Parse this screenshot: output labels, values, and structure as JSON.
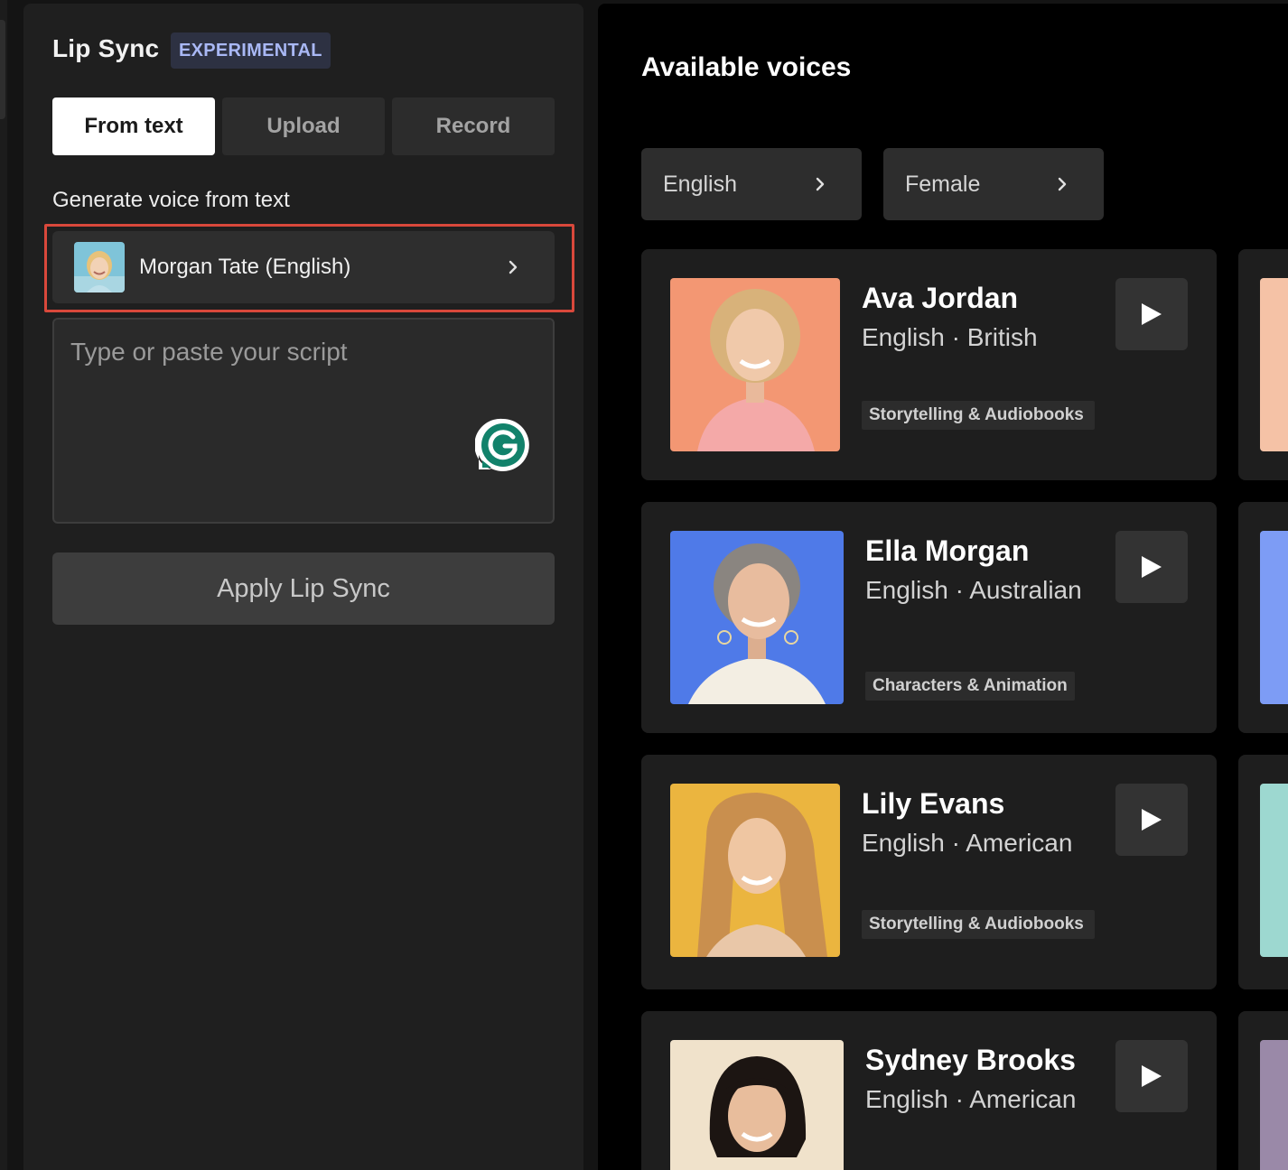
{
  "left_panel": {
    "title": "Lip Sync",
    "badge": "EXPERIMENTAL",
    "tabs": [
      {
        "label": "From text",
        "active": true
      },
      {
        "label": "Upload",
        "active": false
      },
      {
        "label": "Record",
        "active": false
      }
    ],
    "section_label": "Generate voice from text",
    "selected_voice": "Morgan Tate (English)",
    "script_placeholder": "Type or paste your script",
    "apply_button": "Apply Lip Sync"
  },
  "right_panel": {
    "title": "Available voices",
    "filters": [
      {
        "label": "English"
      },
      {
        "label": "Female"
      }
    ],
    "voices": [
      {
        "name": "Ava Jordan",
        "language": "English",
        "accent": "British",
        "tag": "Storytelling & Audiobooks",
        "bg_color": "#f39773"
      },
      {
        "name": "Ella Morgan",
        "language": "English",
        "accent": "Australian",
        "tag": "Characters & Animation",
        "bg_color": "#4f7ae8"
      },
      {
        "name": "Lily Evans",
        "language": "English",
        "accent": "American",
        "tag": "Storytelling & Audiobooks",
        "bg_color": "#ebb53f"
      },
      {
        "name": "Sydney Brooks",
        "language": "English",
        "accent": "American",
        "tag": "",
        "bg_color": "#f0e2cb"
      }
    ],
    "peek_colors": [
      "#f5c2a6",
      "#7d9cf5",
      "#9dd8d0",
      "#9a89a8"
    ]
  },
  "colors": {
    "highlight_outline": "#d9483b",
    "badge_text": "#a9b8f5",
    "grammar_green": "#12826b"
  }
}
